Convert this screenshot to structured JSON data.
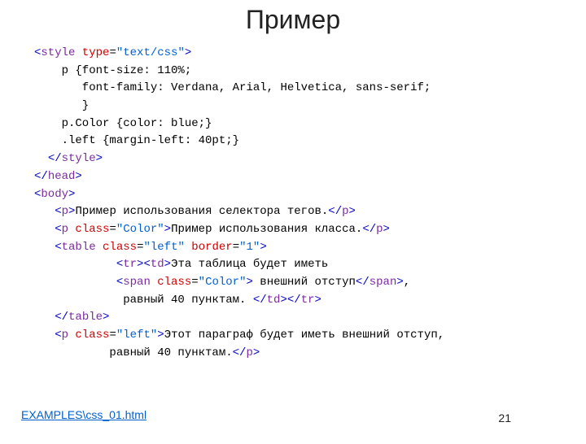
{
  "title": "Пример",
  "link": "EXAMPLES\\css_01.html",
  "page": "21",
  "code": {
    "style_open_lt": "<",
    "style_tag": "style",
    "style_attr": " type",
    "style_eq": "=",
    "style_val": "\"text/css\"",
    "gt": ">",
    "rule1": "    p {font-size: 110%;",
    "rule2": "       font-family: Verdana, Arial, Helvetica, sans-serif;",
    "rule3": "       }",
    "rule4": "    p.Color {color: blue;}",
    "rule5": "    .left {margin-left: 40pt;}",
    "style_close": "style",
    "head_close": "head",
    "body_open": "body",
    "p_tag": "p",
    "p_text1": "Пример использования селектора тегов.",
    "class_attr": " class",
    "color_val": "\"Color\"",
    "p_text2": "Пример использования класса.",
    "table_tag": "table",
    "left_val": "\"left\"",
    "border_attr": " border",
    "border_val": "\"1\"",
    "tr_tag": "tr",
    "td_tag": "td",
    "td_text1": "Эта таблица будет иметь",
    "span_tag": "span",
    "span_text": " внешний отступ",
    "td_text2": ",",
    "td_text3": "             равный 40 пунктам. ",
    "p_text3a": "Этот параграф будет иметь внешний отступ,",
    "p_text3b": "           равный 40 пунктам."
  }
}
